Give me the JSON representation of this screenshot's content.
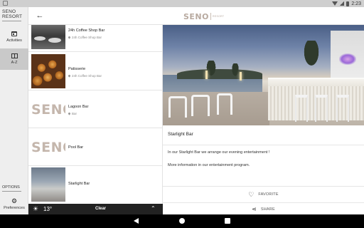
{
  "status_bar": {
    "time": "2:23"
  },
  "sidebar": {
    "brand_line1": "SENO",
    "brand_line2": "RESORT",
    "items": [
      {
        "label": "Activities",
        "icon": "calendar-icon"
      },
      {
        "label": "A-Z",
        "icon": "book-icon",
        "active": true
      }
    ],
    "options_label": "OPTIONS",
    "preferences_label": "Preferences"
  },
  "appbar": {
    "logo_text": "SENO",
    "logo_sub": "RESORT"
  },
  "list": {
    "items": [
      {
        "name": "24h Coffee Shop Bar",
        "location": "24h Coffee Shop Bar",
        "thumb": "photo"
      },
      {
        "name": "Patisserie",
        "location": "24h Coffee Shop Bar",
        "thumb": "photo"
      },
      {
        "name": "Lagoon Bar",
        "location": "Bar",
        "thumb": "logo",
        "thumb_text": "SENO"
      },
      {
        "name": "Pool Bar",
        "location": "",
        "thumb": "logo",
        "thumb_text": "SENO"
      },
      {
        "name": "Starlight Bar",
        "location": "",
        "thumb": "photo"
      }
    ]
  },
  "detail": {
    "title": "Starlight Bar",
    "description_1": "In our Starlight Bar we arrange our evening entertainment !",
    "description_2": "More information in our entertainment program.",
    "favorite_label": "FAVORITE",
    "share_label": "SHARE"
  },
  "weather": {
    "temp": "13°",
    "condition": "Clear"
  }
}
